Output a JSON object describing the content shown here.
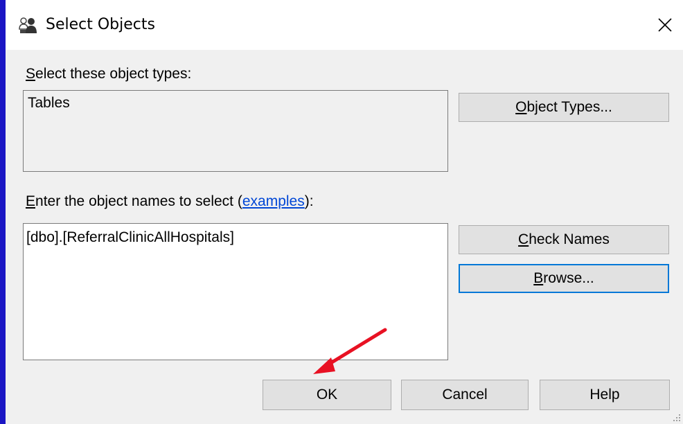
{
  "window": {
    "title": "Select Objects",
    "icon": "users-icon",
    "close_glyph": "✕"
  },
  "object_types": {
    "label_prefix": "",
    "label_mnemonic": "S",
    "label_rest": "elect these object types:",
    "value": "Tables",
    "button_mnemonic": "O",
    "button_rest": "bject Types..."
  },
  "object_names": {
    "label_mnemonic": "E",
    "label_rest": "nter the object names to select (",
    "link_text": "examples",
    "label_suffix": "):",
    "value": "[dbo].[ReferralClinicAllHospitals]"
  },
  "buttons": {
    "check_names_mnemonic": "C",
    "check_names_rest": "heck Names",
    "browse_mnemonic": "B",
    "browse_rest": "rowse...",
    "ok": "OK",
    "cancel": "Cancel",
    "help": "Help"
  },
  "colors": {
    "annotation_arrow": "#e81123",
    "focus_border": "#0078d7",
    "link": "#0047d6"
  }
}
